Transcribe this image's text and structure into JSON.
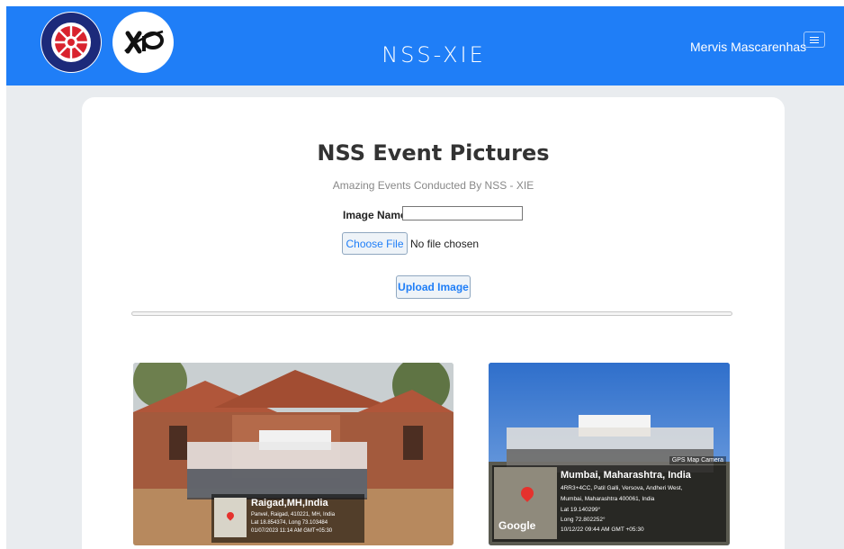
{
  "navbar": {
    "brand": "NSS-XIE",
    "user_name": "Mervis Mascarenhas",
    "logos": [
      "nss-logo-icon",
      "xie-logo-icon"
    ],
    "menu_icon": "hamburger-icon",
    "color": "#1f7ef7"
  },
  "content": {
    "title": "NSS Event Pictures",
    "subtitle": "Amazing Events Conducted By NSS - XIE",
    "image_name_label": "Image Name",
    "image_name_value": "",
    "choose_file_label": "Choose File",
    "file_status": "No file chosen",
    "upload_label": "Upload Image"
  },
  "photos": [
    {
      "location": "Raigad,MH,India",
      "address": "Panvel, Raigad, 410221, MH, India",
      "coords": "Lat 18.854374, Long 73.103484",
      "timestamp": "01/07/2023 11:14 AM GMT+05:30"
    },
    {
      "location": "Mumbai, Maharashtra, India",
      "address_1": "4RR3+4CC, Patil Galli, Versova, Andheri West,",
      "address_2": "Mumbai, Maharashtra 400061, India",
      "lat": "Lat 19.140299°",
      "long": "Long 72.802252°",
      "timestamp": "10/12/22 09:44 AM GMT +05:30",
      "camera_tag": "GPS Map Camera",
      "map_brand": "Google"
    }
  ]
}
